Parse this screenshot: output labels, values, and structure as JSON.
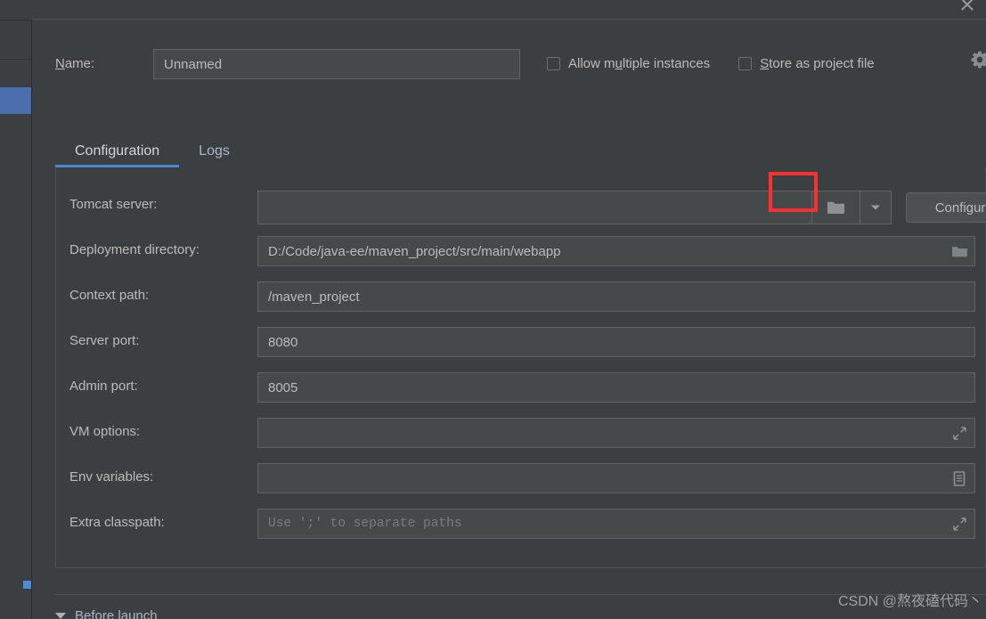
{
  "window": {
    "close_icon": "close-icon"
  },
  "header": {
    "name_label": "Name:",
    "name_label_mnemonic": "N",
    "name_label_rest": "ame:",
    "name_value": "Unnamed",
    "name_placeholder": "Unnamed",
    "checkboxes": [
      {
        "label_pre": "Allow m",
        "mnemonic": "u",
        "label_post": "ltiple instances",
        "checked": false,
        "full": "Allow multiple instances"
      },
      {
        "label_pre": "",
        "mnemonic": "S",
        "label_post": "tore as project file",
        "checked": false,
        "full": "Store as project file"
      }
    ],
    "gear_icon": "gear-icon"
  },
  "tabs": [
    {
      "label": "Configuration",
      "active": true
    },
    {
      "label": "Logs",
      "active": false
    }
  ],
  "form": {
    "tomcat_server": {
      "label": "Tomcat server:",
      "value": "",
      "browse_icon": "folder-icon",
      "dropdown_icon": "chevron-down-icon",
      "configure_label": "Configure..."
    },
    "rows": [
      {
        "label": "Deployment directory:",
        "value": "D:/Code/java-ee/maven_project/src/main/webapp",
        "is_placeholder": false,
        "icon": "folder-icon"
      },
      {
        "label": "Context path:",
        "value": "/maven_project",
        "is_placeholder": false,
        "icon": ""
      },
      {
        "label": "Server port:",
        "value": "8080",
        "is_placeholder": false,
        "icon": ""
      },
      {
        "label": "Admin port:",
        "value": "8005",
        "is_placeholder": false,
        "icon": ""
      },
      {
        "label": "VM options:",
        "value": "",
        "is_placeholder": false,
        "icon": "expand-icon"
      },
      {
        "label": "Env variables:",
        "value": "",
        "is_placeholder": false,
        "icon": "list-document-icon"
      },
      {
        "label": "Extra classpath:",
        "value": "Use ';' to separate paths",
        "is_placeholder": true,
        "icon": "expand-icon"
      }
    ]
  },
  "footer": {
    "before_launch_label": "Before launch",
    "watermark": "CSDN @熬夜磕代码丶"
  },
  "colors": {
    "background": "#3c3f41",
    "field": "#45494a",
    "accent_blue": "#4b6eaf",
    "tab_underline": "#4a88c7",
    "highlight_red": "#fc3030",
    "text": "#bbbbbb"
  }
}
